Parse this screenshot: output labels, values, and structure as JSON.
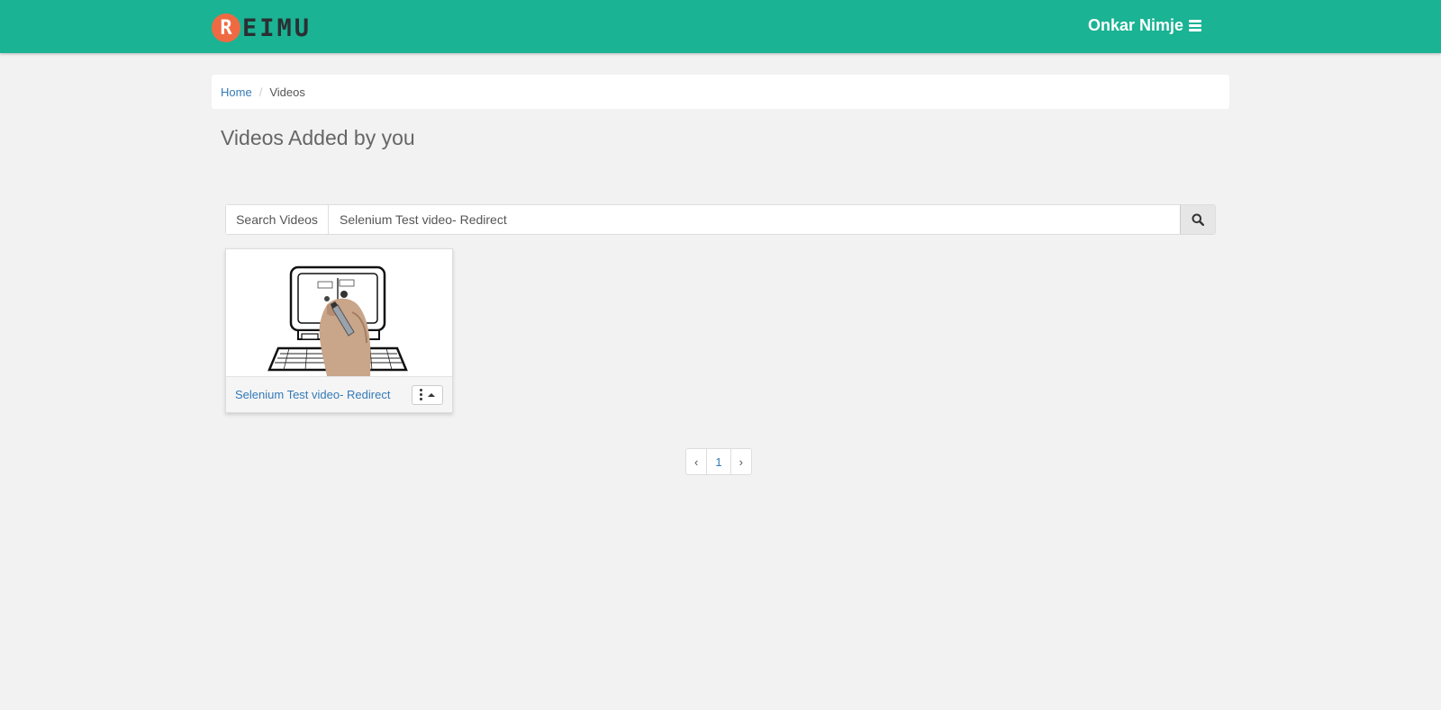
{
  "header": {
    "logo_badge": "R",
    "logo_text": "EIMU",
    "user_name": "Onkar Nimje",
    "menu_icon": "bars-icon",
    "brand_color": "#1ab394",
    "logo_accent": "#ef6a42"
  },
  "breadcrumb": {
    "home": "Home",
    "separator": "/",
    "current": "Videos"
  },
  "page": {
    "title": "Videos Added by you"
  },
  "search": {
    "label": "Search Videos",
    "value": "Selenium Test video- Redirect",
    "button_icon": "search-icon"
  },
  "videos": [
    {
      "title": "Selenium Test video- Redirect",
      "thumbnail": "hand-drawing-computer-thumbnail"
    }
  ],
  "pagination": {
    "prev": "‹",
    "current": "1",
    "next": "›"
  }
}
